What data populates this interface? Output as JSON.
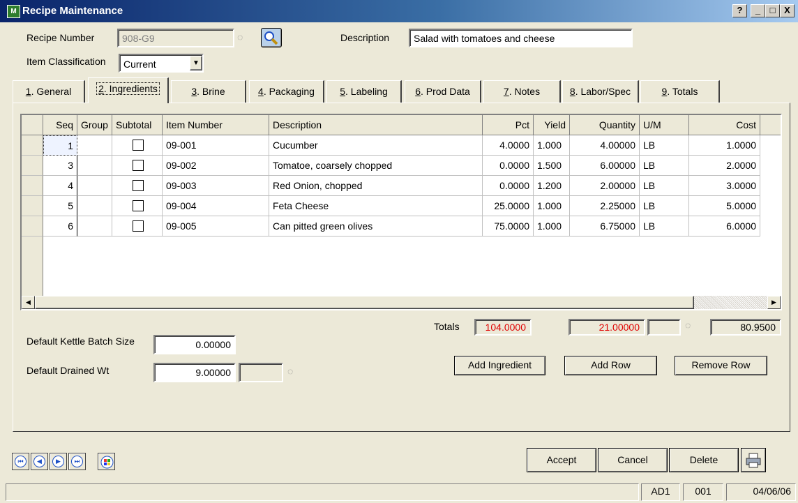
{
  "window": {
    "title": "Recipe Maintenance",
    "icon_text": "M",
    "help_button": "?",
    "minimize_button": "_",
    "maximize_button": "□",
    "close_button": "X"
  },
  "header": {
    "recipe_number_label": "Recipe Number",
    "recipe_number_value": "908-G9",
    "description_label": "Description",
    "description_value": "Salad with tomatoes and cheese",
    "item_classification_label": "Item Classification",
    "item_classification_value": "Current"
  },
  "tabs": [
    {
      "num": "1",
      "label": ". General"
    },
    {
      "num": "2",
      "label": ". Ingredients"
    },
    {
      "num": "3",
      "label": ". Brine"
    },
    {
      "num": "4",
      "label": ". Packaging"
    },
    {
      "num": "5",
      "label": ". Labeling"
    },
    {
      "num": "6",
      "label": ". Prod Data"
    },
    {
      "num": "7",
      "label": ". Notes"
    },
    {
      "num": "8",
      "label": ". Labor/Spec"
    },
    {
      "num": "9",
      "label": ". Totals"
    }
  ],
  "active_tab": "2. Ingredients",
  "grid": {
    "columns": [
      "Seq",
      "Group",
      "Subtotal",
      "Item Number",
      "Description",
      "Pct",
      "Yield",
      "Quantity",
      "U/M",
      "Cost"
    ],
    "rows": [
      {
        "seq": "1",
        "group": "",
        "subtotal": false,
        "item_number": "09-001",
        "description": "Cucumber",
        "pct": "4.0000",
        "yield": "1.000",
        "quantity": "4.00000",
        "um": "LB",
        "cost": "1.0000"
      },
      {
        "seq": "3",
        "group": "",
        "subtotal": false,
        "item_number": "09-002",
        "description": "Tomatoe, coarsely chopped",
        "pct": "0.0000",
        "yield": "1.500",
        "quantity": "6.00000",
        "um": "LB",
        "cost": "2.0000"
      },
      {
        "seq": "4",
        "group": "",
        "subtotal": false,
        "item_number": "09-003",
        "description": "Red Onion, chopped",
        "pct": "0.0000",
        "yield": "1.200",
        "quantity": "2.00000",
        "um": "LB",
        "cost": "3.0000"
      },
      {
        "seq": "5",
        "group": "",
        "subtotal": false,
        "item_number": "09-004",
        "description": "Feta Cheese",
        "pct": "25.0000",
        "yield": "1.000",
        "quantity": "2.25000",
        "um": "LB",
        "cost": "5.0000"
      },
      {
        "seq": "6",
        "group": "",
        "subtotal": false,
        "item_number": "09-005",
        "description": "Can pitted green olives",
        "pct": "75.0000",
        "yield": "1.000",
        "quantity": "6.75000",
        "um": "LB",
        "cost": "6.0000"
      }
    ]
  },
  "totals": {
    "label": "Totals",
    "pct": "104.0000",
    "quantity": "21.00000",
    "cost": "80.9500"
  },
  "fields": {
    "kettle_batch_label": "Default Kettle Batch Size",
    "kettle_batch_value": "0.00000",
    "drained_wt_label": "Default Drained Wt",
    "drained_wt_value": "9.00000"
  },
  "buttons": {
    "add_ingredient": "Add Ingredient",
    "add_row": "Add Row",
    "remove_row": "Remove Row",
    "accept": "Accept",
    "cancel": "Cancel",
    "delete": "Delete"
  },
  "status": {
    "company": "AD1",
    "user": "001",
    "date": "04/06/06"
  },
  "colors": {
    "title_gradient_start": "#0a246a",
    "window_face": "#ece9d8",
    "totals_alert": "#e00000"
  }
}
